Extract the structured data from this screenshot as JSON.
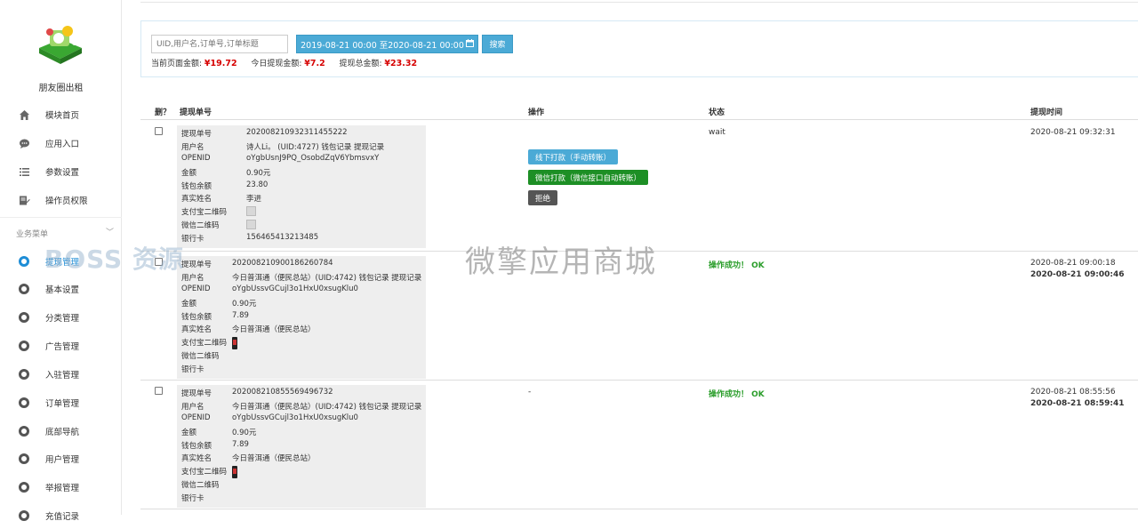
{
  "sidebar": {
    "brand": "朋友圈出租",
    "top_items": [
      {
        "label": "模块首页",
        "icon": "home-icon"
      },
      {
        "label": "应用入口",
        "icon": "chat-icon"
      },
      {
        "label": "参数设置",
        "icon": "list-icon"
      },
      {
        "label": "操作员权限",
        "icon": "edit-icon"
      }
    ],
    "section_label": "业务菜单",
    "items": [
      {
        "label": "提现管理",
        "icon": "gear-icon",
        "active": true
      },
      {
        "label": "基本设置",
        "icon": "gear-icon"
      },
      {
        "label": "分类管理",
        "icon": "gear-icon"
      },
      {
        "label": "广告管理",
        "icon": "gear-icon"
      },
      {
        "label": "入驻管理",
        "icon": "gear-icon"
      },
      {
        "label": "订单管理",
        "icon": "gear-icon"
      },
      {
        "label": "底部导航",
        "icon": "gear-icon"
      },
      {
        "label": "用户管理",
        "icon": "gear-icon"
      },
      {
        "label": "举报管理",
        "icon": "gear-icon"
      },
      {
        "label": "充值记录",
        "icon": "gear-icon"
      }
    ]
  },
  "filter": {
    "search_placeholder": "UID,用户名,订单号,订单标题",
    "date_range": "2019-08-21 00:00 至2020-08-21 00:00",
    "search_label": "搜索",
    "summary": {
      "page_label": "当前页面金额:",
      "page_amount": "¥19.72",
      "today_label": "今日提现金额:",
      "today_amount": "¥7.2",
      "total_label": "提现总金额:",
      "total_amount": "¥23.32"
    }
  },
  "table": {
    "headers": {
      "delete": "删？",
      "order_no": "提现单号",
      "action": "操作",
      "status": "状态",
      "time": "提现时间"
    },
    "field_labels": {
      "order_no": "提现单号",
      "username": "用户名",
      "openid": "OPENID",
      "amount": "金额",
      "wallet": "钱包余额",
      "real_name": "真实姓名",
      "alipay_qr": "支付宝二维码",
      "wechat_qr": "微信二维码",
      "bank_card": "银行卡"
    },
    "rows": [
      {
        "order_no": "202008210932311455222",
        "username": "诗人Li。 (UID:4727) 钱包记录 提现记录",
        "openid": "oYgbUsnJ9PQ_OsobdZqV6YbmsvxY",
        "amount": "0.90元",
        "wallet": "23.80",
        "real_name": "李进",
        "bank_card": "156465413213485",
        "status": "wait",
        "time_apply": "2020-08-21 09:32:31",
        "time_done": "",
        "actions": {
          "offline": "线下打款（手动转账）",
          "wechat": "微信打款（微信接口自动转账）",
          "reject": "拒绝"
        }
      },
      {
        "order_no": "202008210900186260784",
        "username": "今日普洱通（便民总站）(UID:4742) 钱包记录 提现记录",
        "openid": "oYgbUssvGCujl3o1HxU0xsugKlu0",
        "amount": "0.90元",
        "wallet": "7.89",
        "real_name": "今日普洱通（便民总站）",
        "bank_card": "",
        "status": "操作成功！ OK",
        "time_apply": "2020-08-21 09:00:18",
        "time_done": "2020-08-21 09:00:46",
        "action_text": ""
      },
      {
        "order_no": "202008210855569496732",
        "username": "今日普洱通（便民总站）(UID:4742) 钱包记录 提现记录",
        "openid": "oYgbUssvGCujl3o1HxU0xsugKlu0",
        "amount": "0.90元",
        "wallet": "7.89",
        "real_name": "今日普洱通（便民总站）",
        "bank_card": "",
        "status": "操作成功！ OK",
        "time_apply": "2020-08-21 08:55:56",
        "time_done": "2020-08-21 08:59:41",
        "action_text": "-"
      }
    ]
  },
  "watermarks": {
    "left": "BOSS 资源",
    "center": "微擎应用商城"
  },
  "colors": {
    "accent": "#4baad6",
    "success": "#2a9d2a",
    "money": "#d60000",
    "green_button": "#1d8f25"
  }
}
